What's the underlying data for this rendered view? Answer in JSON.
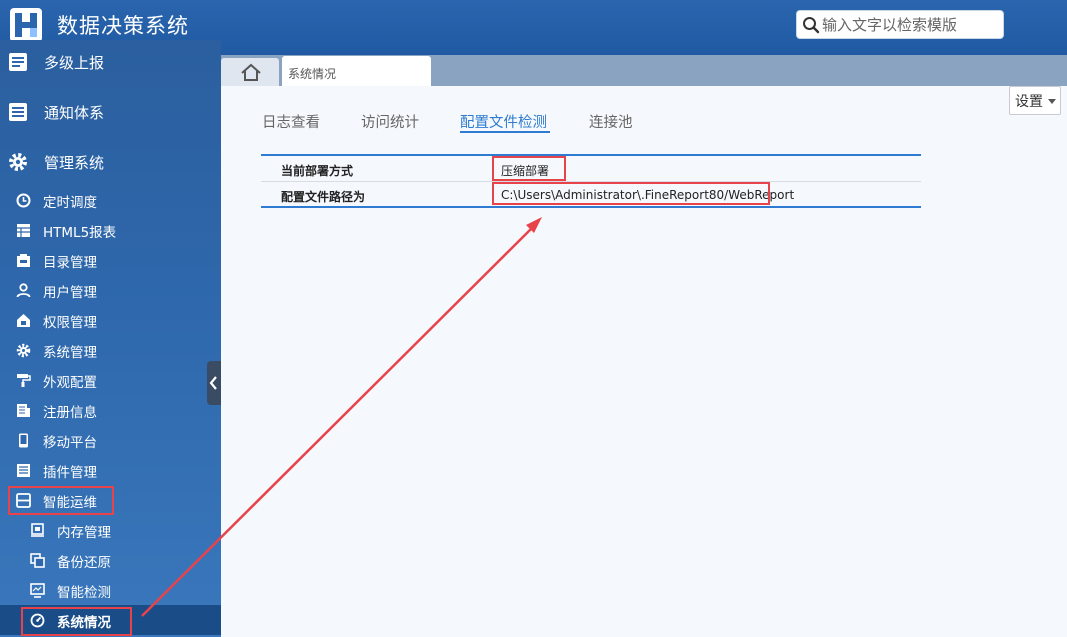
{
  "header": {
    "app_title": "数据决策系统",
    "search_placeholder": "输入文字以检索模版"
  },
  "sidebar": {
    "top_items": [
      {
        "label": "多级上报",
        "icon": "report-icon"
      },
      {
        "label": "通知体系",
        "icon": "notice-icon"
      },
      {
        "label": "管理系统",
        "icon": "gear-icon"
      }
    ],
    "items": [
      {
        "label": "定时调度",
        "icon": "clock-icon"
      },
      {
        "label": "HTML5报表",
        "icon": "table-icon"
      },
      {
        "label": "目录管理",
        "icon": "directory-icon"
      },
      {
        "label": "用户管理",
        "icon": "user-icon"
      },
      {
        "label": "权限管理",
        "icon": "lock-icon"
      },
      {
        "label": "系统管理",
        "icon": "settings-icon"
      },
      {
        "label": "外观配置",
        "icon": "paint-roller-icon"
      },
      {
        "label": "注册信息",
        "icon": "register-icon"
      },
      {
        "label": "移动平台",
        "icon": "mobile-icon"
      },
      {
        "label": "插件管理",
        "icon": "plugin-icon"
      },
      {
        "label": "智能运维",
        "icon": "maintenance-icon"
      }
    ],
    "sub_items": [
      {
        "label": "内存管理",
        "icon": "memory-icon"
      },
      {
        "label": "备份还原",
        "icon": "backup-icon"
      },
      {
        "label": "智能检测",
        "icon": "monitor-icon"
      },
      {
        "label": "系统情况",
        "icon": "dashboard-icon"
      }
    ]
  },
  "tabs": {
    "home_icon": "home-icon",
    "active_tab": "系统情况"
  },
  "content": {
    "settings_label": "设置",
    "subtabs": [
      "日志查看",
      "访问统计",
      "配置文件检测",
      "连接池"
    ],
    "active_subtab": "配置文件检测",
    "rows": [
      {
        "key": "当前部署方式",
        "value": "压缩部署"
      },
      {
        "key": "配置文件路径为",
        "value": "C:\\Users\\Administrator\\.FineReport80/WebReport"
      }
    ]
  },
  "colors": {
    "header_bg": "#2a65ae",
    "sidebar_bg": "#2e67ab",
    "accent": "#2e7bd1",
    "highlight_box": "#e8434a"
  }
}
